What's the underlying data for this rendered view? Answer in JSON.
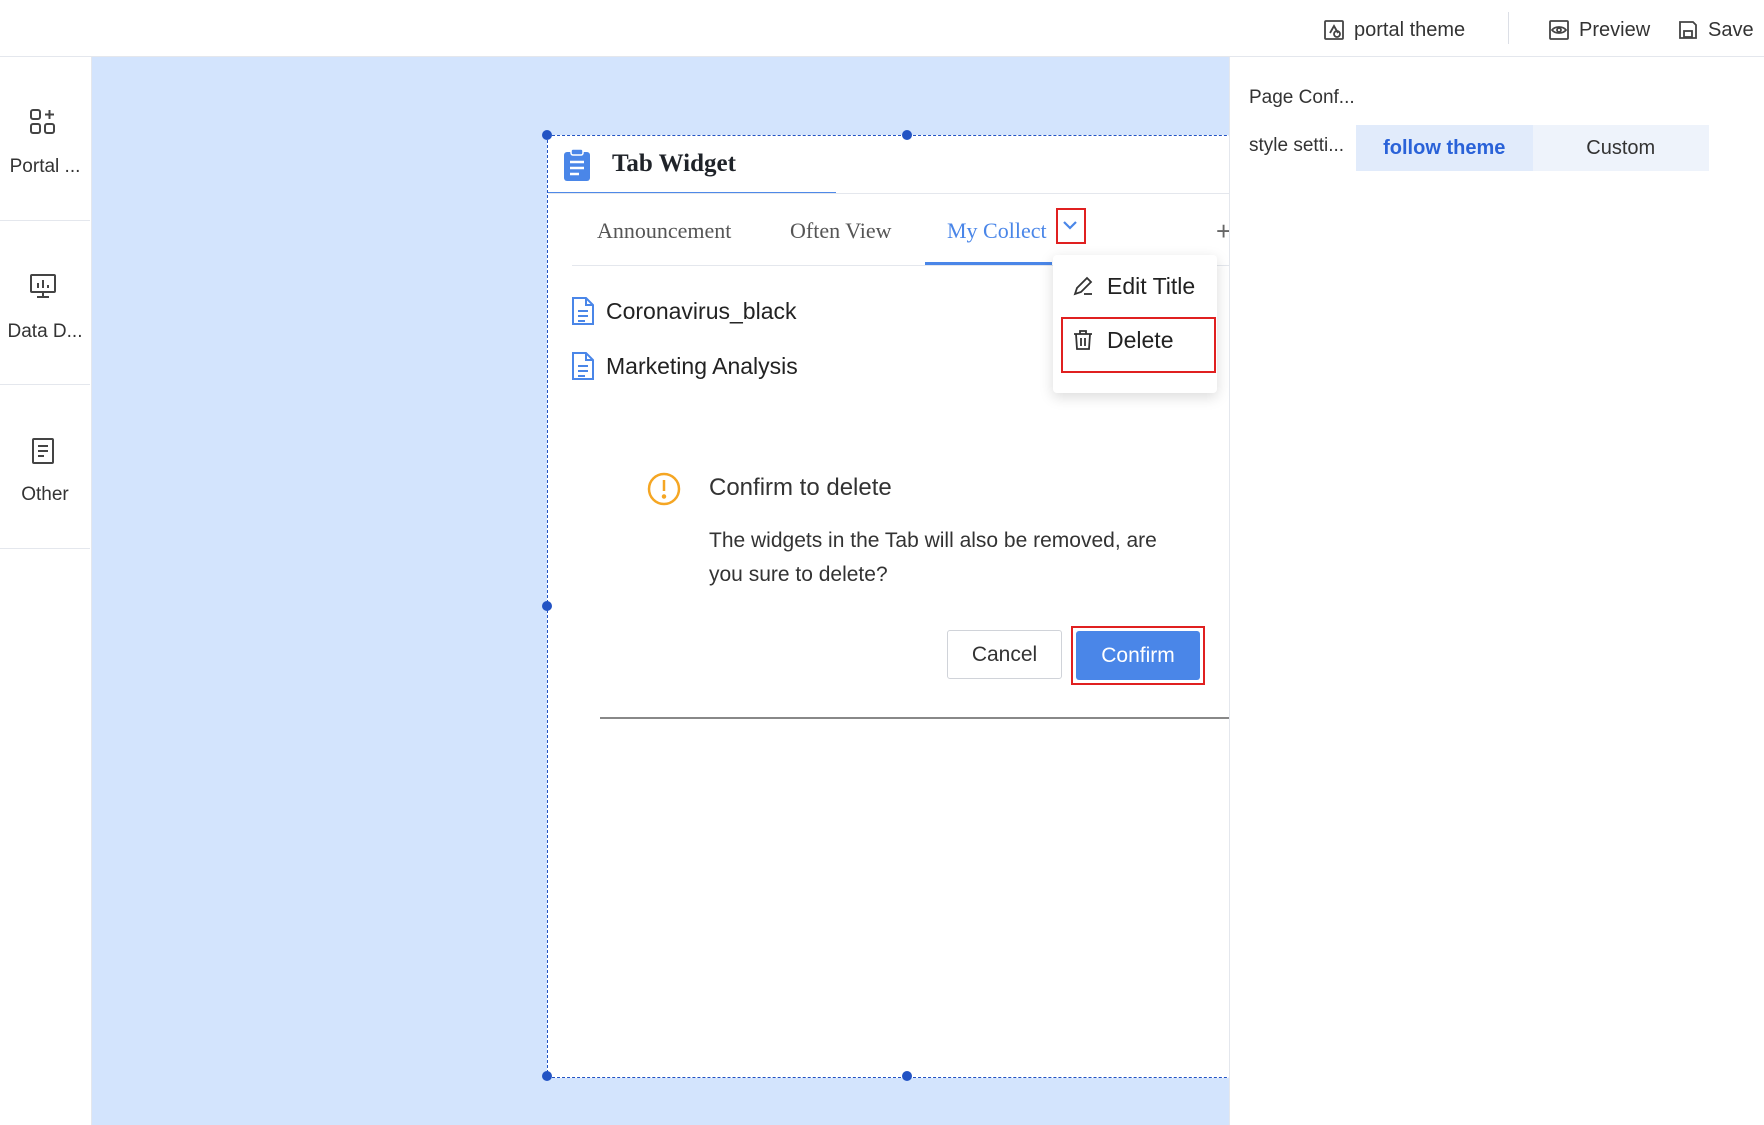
{
  "toolbar": {
    "theme_label": "portal theme",
    "preview_label": "Preview",
    "save_label": "Save"
  },
  "sidebar": {
    "items": [
      {
        "label": "Portal ...",
        "icon": "widgets-icon"
      },
      {
        "label": "Data D...",
        "icon": "chart-icon"
      },
      {
        "label": "Other",
        "icon": "document-icon"
      }
    ]
  },
  "widget": {
    "title": "Tab Widget",
    "tabs": [
      "Announcement",
      "Often View",
      "My Collect"
    ],
    "active_tab": 2,
    "files": [
      "Coronavirus_black",
      "Marketing Analysis"
    ],
    "menu": {
      "edit_title": "Edit Title",
      "delete": "Delete"
    }
  },
  "dialog": {
    "title": "Confirm to delete",
    "message": "The widgets in the Tab will also be removed, are you sure to delete?",
    "cancel_label": "Cancel",
    "confirm_label": "Confirm"
  },
  "right_panel": {
    "page_config_label": "Page Conf...",
    "style_label": "style setti...",
    "style_options": [
      "follow theme",
      "Custom"
    ],
    "selected_style": "follow theme"
  },
  "colors": {
    "accent": "#4a86e8",
    "canvas": "#d3e4fd",
    "highlight": "#e02020",
    "warning": "#f5a623"
  }
}
